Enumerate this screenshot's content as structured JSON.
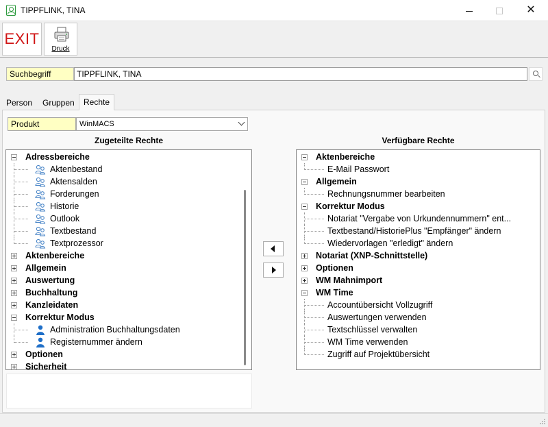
{
  "window": {
    "title": "TIPPFLINK, TINA"
  },
  "toolbar": {
    "exit_label": "EXIT",
    "print_label": "Druck"
  },
  "search": {
    "label": "Suchbegriff",
    "value": "TIPPFLINK, TINA"
  },
  "tabs": [
    {
      "label": "Person"
    },
    {
      "label": "Gruppen"
    },
    {
      "label": "Rechte",
      "active": true
    }
  ],
  "product": {
    "label": "Produkt",
    "selected": "WinMACS"
  },
  "assigned": {
    "heading": "Zugeteilte Rechte",
    "groups": [
      {
        "label": "Adressbereiche",
        "expanded": true,
        "items": [
          "Aktenbestand",
          "Aktensalden",
          "Forderungen",
          "Historie",
          "Outlook",
          "Textbestand",
          "Textprozessor"
        ]
      },
      {
        "label": "Aktenbereiche",
        "expanded": false
      },
      {
        "label": "Allgemein",
        "expanded": false
      },
      {
        "label": "Auswertung",
        "expanded": false
      },
      {
        "label": "Buchhaltung",
        "expanded": false
      },
      {
        "label": "Kanzleidaten",
        "expanded": false
      },
      {
        "label": "Korrektur Modus",
        "expanded": true,
        "items": [
          "Administration Buchhaltungsdaten",
          "Registernummer ändern"
        ]
      },
      {
        "label": "Optionen",
        "expanded": false
      },
      {
        "label": "Sicherheit",
        "expanded": false
      }
    ]
  },
  "available": {
    "heading": "Verfügbare Rechte",
    "groups": [
      {
        "label": "Aktenbereiche",
        "expanded": true,
        "items": [
          "E-Mail Passwort"
        ]
      },
      {
        "label": "Allgemein",
        "expanded": true,
        "items": [
          "Rechnungsnummer bearbeiten"
        ]
      },
      {
        "label": "Korrektur Modus",
        "expanded": true,
        "items": [
          "Notariat \"Vergabe von Urkundennummern\" ent...",
          "Textbestand/HistoriePlus \"Empfänger\" ändern",
          "Wiedervorlagen \"erledigt\" ändern"
        ]
      },
      {
        "label": "Notariat (XNP-Schnittstelle)",
        "expanded": false
      },
      {
        "label": "Optionen",
        "expanded": false
      },
      {
        "label": "WM Mahnimport",
        "expanded": false
      },
      {
        "label": "WM Time",
        "expanded": true,
        "items": [
          "Accountübersicht Vollzugriff",
          "Auswertungen verwenden",
          "Textschlüssel verwalten",
          "WM Time verwenden",
          "Zugriff auf Projektübersicht"
        ]
      }
    ]
  },
  "colors": {
    "exit_red": "#d01616",
    "label_yellow": "#ffffc3",
    "icon_green": "#2e9b3f",
    "user_blue": "#1f6fc8"
  }
}
